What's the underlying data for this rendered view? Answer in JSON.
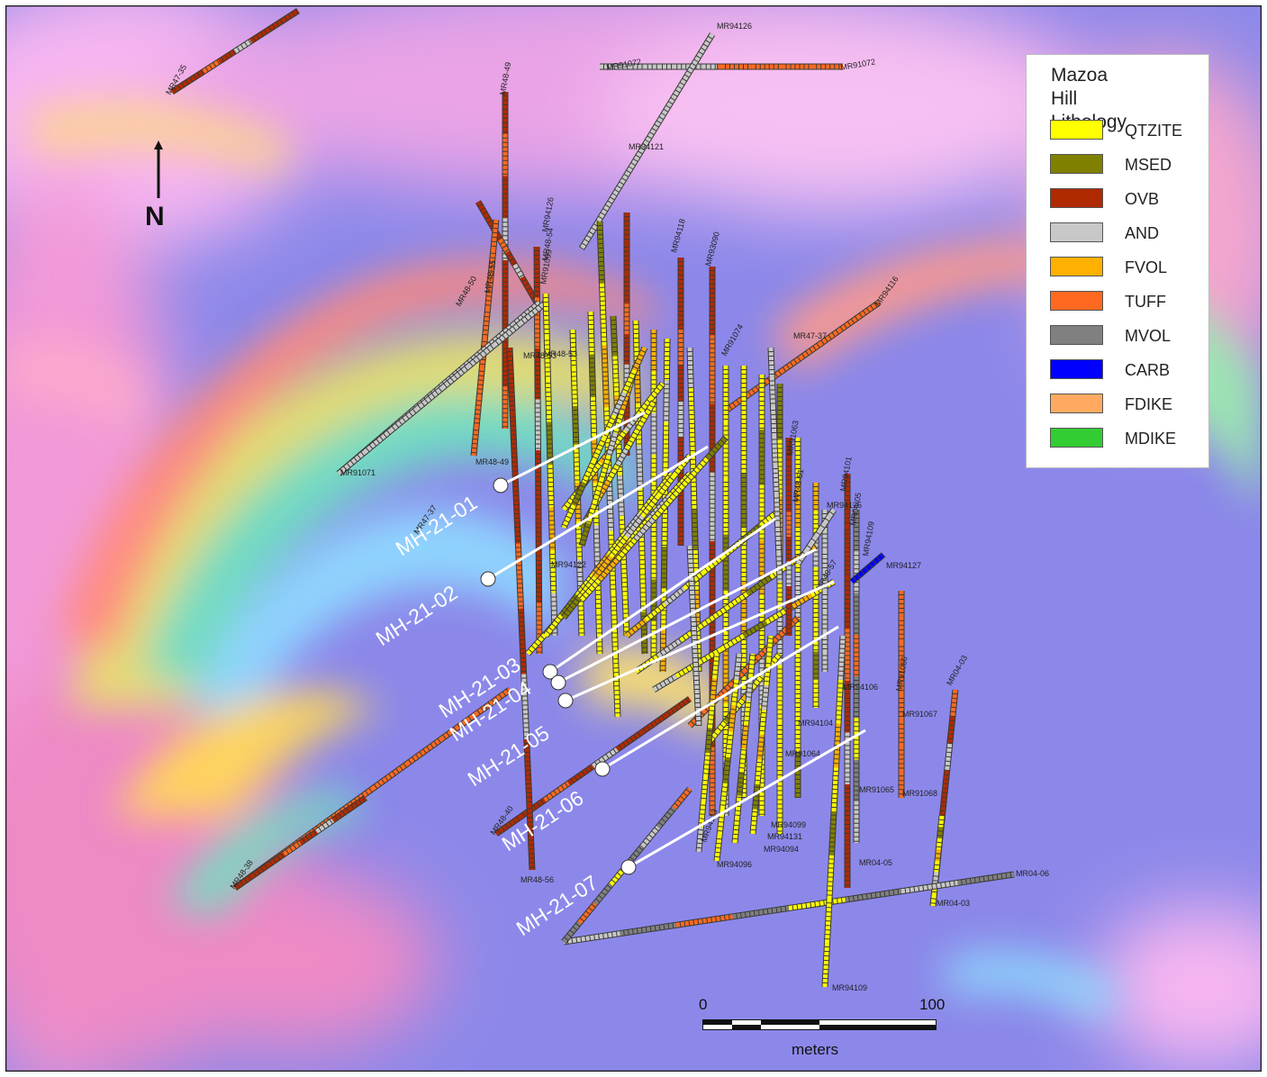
{
  "map": {
    "legend": {
      "title_line1": "Mazoa",
      "title_line2": "Hill",
      "title_line3": "Lithology",
      "items": [
        {
          "code": "QTZITE",
          "color": "#ffff00"
        },
        {
          "code": "MSED",
          "color": "#808000"
        },
        {
          "code": "OVB",
          "color": "#b02a00"
        },
        {
          "code": "AND",
          "color": "#c8c8c8"
        },
        {
          "code": "FVOL",
          "color": "#ffb000"
        },
        {
          "code": "TUFF",
          "color": "#ff6a20"
        },
        {
          "code": "MVOL",
          "color": "#808080"
        },
        {
          "code": "CARB",
          "color": "#0000ff"
        },
        {
          "code": "FDIKE",
          "color": "#ffaa60"
        },
        {
          "code": "MDIKE",
          "color": "#33cc33"
        }
      ]
    },
    "north_arrow": {
      "label": "N"
    },
    "scale_bar": {
      "zero": "0",
      "max": "100",
      "unit": "meters"
    },
    "planned_holes": [
      {
        "label": "MH-21-01"
      },
      {
        "label": "MH-21-02"
      },
      {
        "label": "MH-21-03"
      },
      {
        "label": "MH-21-04"
      },
      {
        "label": "MH-21-05"
      },
      {
        "label": "MH-21-06"
      },
      {
        "label": "MH-21-07"
      }
    ],
    "drill_labels": [
      "MR47-35",
      "MR48-49",
      "MR94126",
      "MR91072",
      "MR91072",
      "MR94121",
      "MR48-53",
      "MR94126",
      "MR48-55",
      "MR48-50",
      "MR48-54",
      "MR91099",
      "MR94118",
      "MR93090",
      "MR91074",
      "MR47-37",
      "MR94116",
      "MR48-53",
      "MR91071",
      "MR48-49",
      "MR47-37",
      "MR94122",
      "MR48-38",
      "MR48-40",
      "MR48-56",
      "MR94113",
      "MR94096",
      "MR94099",
      "MR94094",
      "MR94101",
      "MR94125",
      "MR04-05",
      "MR94109",
      "MR48-57",
      "MR94127",
      "MR91066",
      "MR91067",
      "MR91068",
      "MR04-03",
      "MR04-03",
      "MR04-06",
      "MR04-05",
      "MR91065",
      "MR94109",
      "MR94104",
      "MR91064",
      "MR91063",
      "MR48-51",
      "MR94106",
      "MR94131"
    ]
  }
}
